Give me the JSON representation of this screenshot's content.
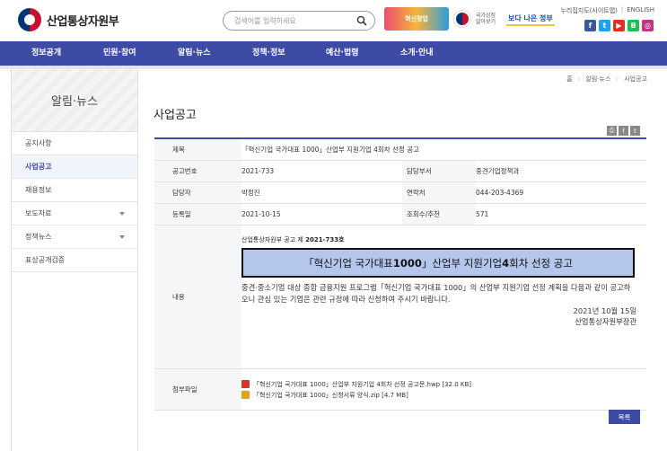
{
  "header": {
    "logo_text": "산업통상자원부",
    "search_placeholder": "검색어를 입력하세요",
    "banner1_text": "혁신창업",
    "banner2_text": "국가상징 알아보기",
    "banner3_text": "보다 나은 정부",
    "toplinks": [
      "누리집지도(사이트맵)",
      "|",
      "ENGLISH"
    ],
    "socials": [
      {
        "name": "facebook",
        "glyph": "f",
        "color": "#3b5998"
      },
      {
        "name": "twitter",
        "glyph": "t",
        "color": "#1da1f2"
      },
      {
        "name": "youtube",
        "glyph": "▶",
        "color": "#e52d27"
      },
      {
        "name": "blog",
        "glyph": "B",
        "color": "#1fbf4f"
      },
      {
        "name": "instagram",
        "glyph": "◎",
        "color": "#c13584"
      }
    ]
  },
  "gnb": [
    "정보공개",
    "민원·참여",
    "알림·뉴스",
    "정책·정보",
    "예산·법령",
    "소개·안내"
  ],
  "sidebar": {
    "title": "알림·뉴스",
    "items": [
      {
        "label": "공지사항"
      },
      {
        "label": "사업공고"
      },
      {
        "label": "채용정보"
      },
      {
        "label": "보도자료"
      },
      {
        "label": "정책뉴스"
      },
      {
        "label": "표상공개검증"
      }
    ]
  },
  "breadcrumb": [
    "홈",
    "알림·뉴스",
    "사업공고"
  ],
  "page_title": "사업공고",
  "detail": {
    "title_label": "제목",
    "title_value": "「혁신기업 국가대표 1000」산업부 지원기업 4회차 선정 공고",
    "notice_no_label": "공고번호",
    "notice_no_value": "2021-733",
    "dept_label": "담당부서",
    "dept_value": "중견기업정책과",
    "manager_label": "담당자",
    "manager_value": "박정진",
    "contact_label": "연락처",
    "contact_value": "044-203-4369",
    "date_label": "등록일",
    "date_value": "2021-10-15",
    "views_label": "조회수/추천",
    "views_value": "571",
    "content_label": "내용",
    "content_notice_no_prefix": "산업통상자원부 공고 제 ",
    "content_notice_no": "2021-733호",
    "content_box_title_pre": "「혁신기업 국가대표 ",
    "content_box_title_num": "1000",
    "content_box_title_mid": "」산업부 지원기업 ",
    "content_box_title_num2": "4",
    "content_box_title_post": "회차 선정 공고",
    "content_body": "중견·중소기업 대상 종합 금융지원 프로그램「혁신기업 국가대표 1000」의 산업부 지원기업 선정 계획을 다음과 같이 공고하오니 관심 있는 기업은 관련 규정에 따라 신청하여 주시기 바랍니다.",
    "content_date": "2021년 10월 15일",
    "content_signer": "산업통상자원부장관",
    "attach_label": "첨부파일",
    "files": [
      {
        "name": "「혁신기업 국가대표 1000」산업부 지원기업 4회차 선정 공고문.hwp [32.0 KB]",
        "color": "#d6382c"
      },
      {
        "name": "「혁신기업 국가대표 1000」신청서류 양식.zip [4.7 MB]",
        "color": "#e3a21a"
      }
    ]
  },
  "list_button": "목록"
}
